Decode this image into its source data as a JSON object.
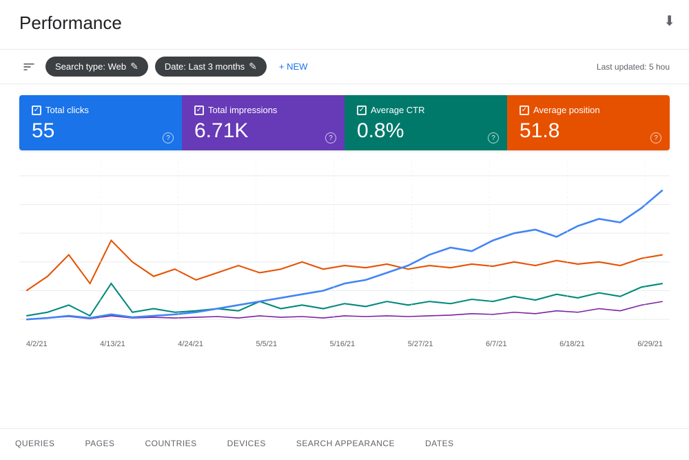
{
  "header": {
    "title": "Performance",
    "last_updated": "Last updated: 5 hou"
  },
  "toolbar": {
    "filter_icon": "≡",
    "search_type_chip": "Search type: Web",
    "date_chip": "Date: Last 3 months",
    "new_label": "+ NEW",
    "edit_icon": "✎"
  },
  "metrics": [
    {
      "id": "total-clicks",
      "label": "Total clicks",
      "value": "55",
      "color": "blue",
      "checked": true
    },
    {
      "id": "total-impressions",
      "label": "Total impressions",
      "value": "6.71K",
      "color": "purple",
      "checked": true
    },
    {
      "id": "average-ctr",
      "label": "Average CTR",
      "value": "0.8%",
      "color": "teal",
      "checked": true
    },
    {
      "id": "average-position",
      "label": "Average position",
      "value": "51.8",
      "color": "orange",
      "checked": true
    }
  ],
  "chart": {
    "x_labels": [
      "4/2/21",
      "4/13/21",
      "4/24/21",
      "5/5/21",
      "5/16/21",
      "5/27/21",
      "6/7/21",
      "6/18/21",
      "6/29/21"
    ],
    "lines": {
      "blue": {
        "color": "#4285f4",
        "label": "Total impressions"
      },
      "orange": {
        "color": "#e65100",
        "label": "Average position"
      },
      "teal": {
        "color": "#00897b",
        "label": "Average CTR"
      },
      "purple": {
        "color": "#7b1fa2",
        "label": "Total clicks"
      }
    }
  },
  "tabs": [
    {
      "id": "queries",
      "label": "QUERIES",
      "active": false
    },
    {
      "id": "pages",
      "label": "PAGES",
      "active": false
    },
    {
      "id": "countries",
      "label": "COUNTRIES",
      "active": false
    },
    {
      "id": "devices",
      "label": "DEVICES",
      "active": false
    },
    {
      "id": "search-appearance",
      "label": "SEARCH APPEARANCE",
      "active": false
    },
    {
      "id": "dates",
      "label": "DATES",
      "active": false
    }
  ]
}
